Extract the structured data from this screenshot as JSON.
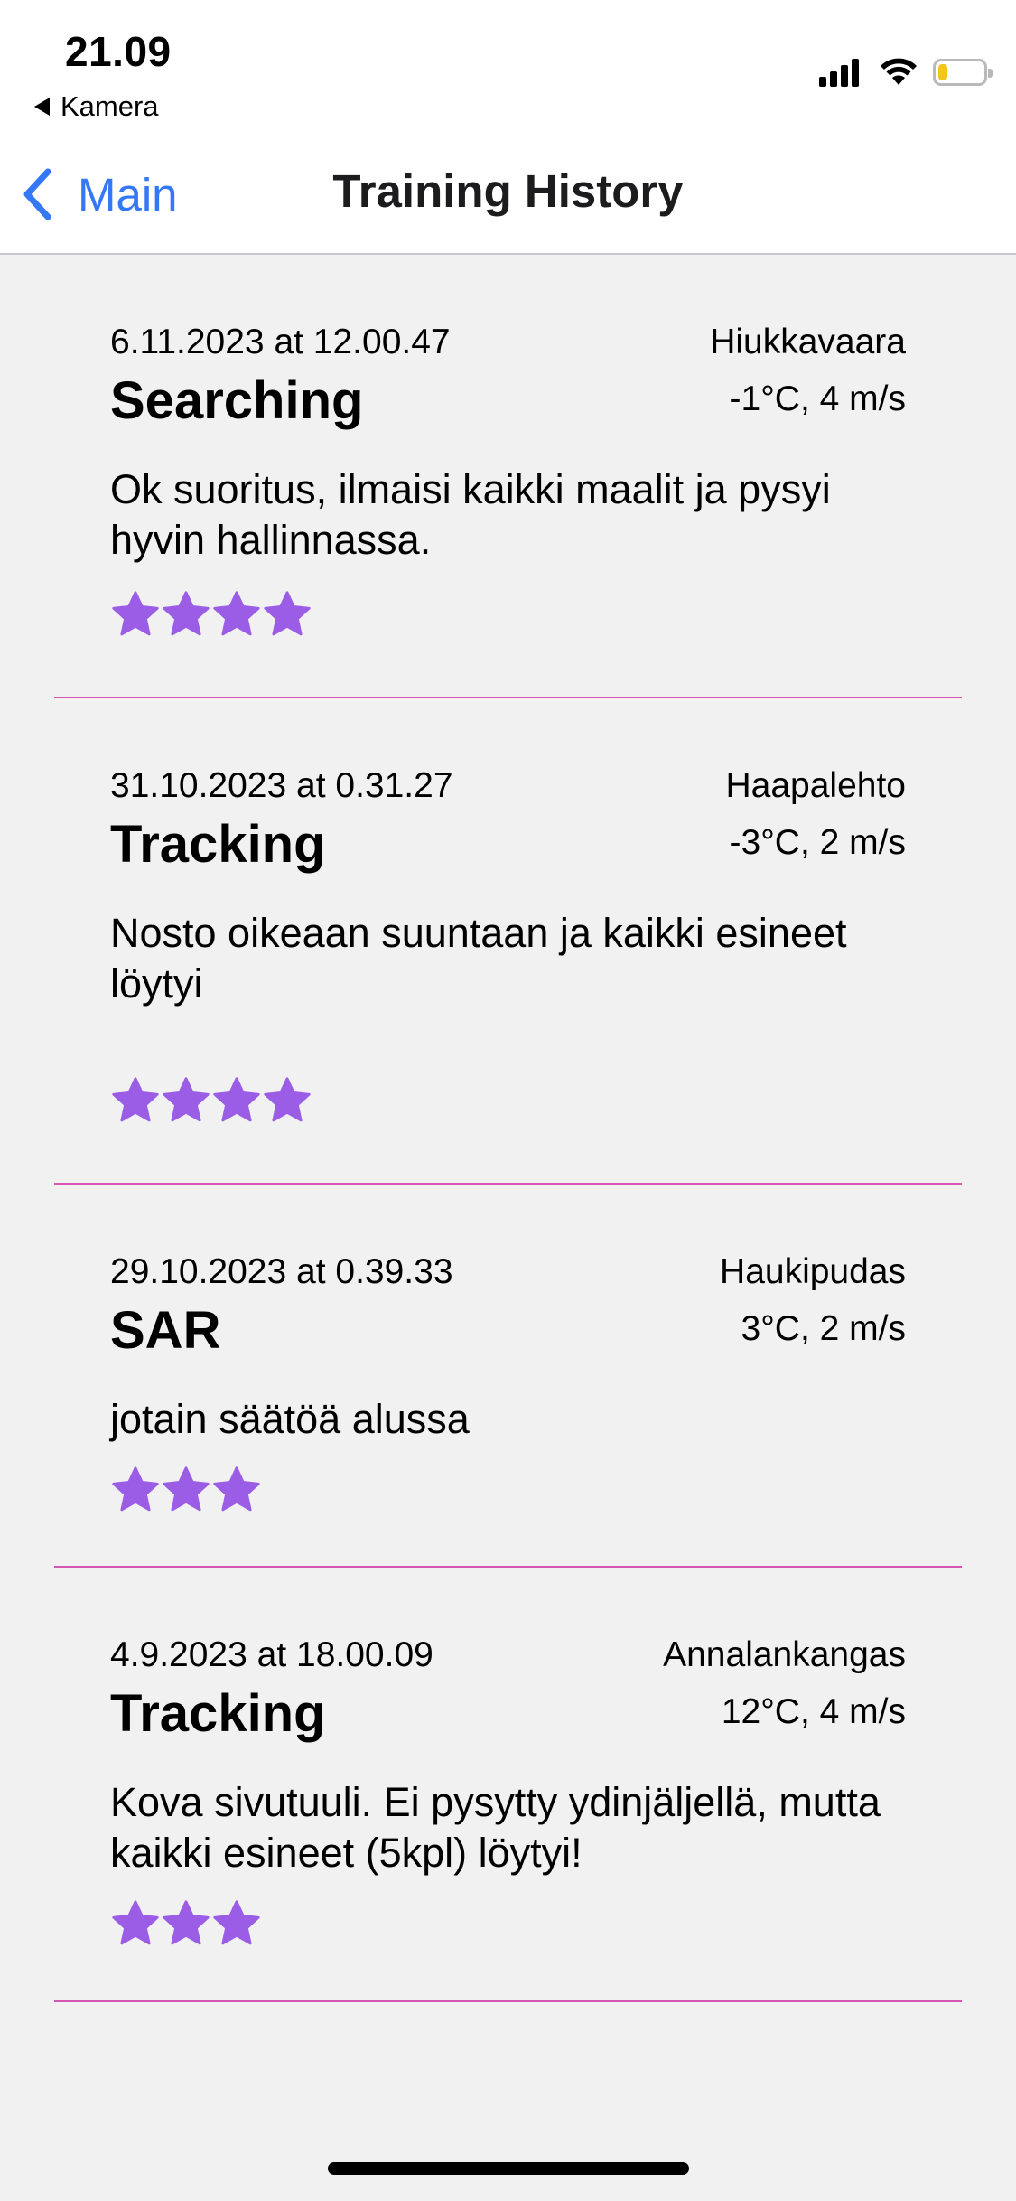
{
  "status_bar": {
    "time": "21.09",
    "back_app": "Kamera",
    "battery_level": 0.2,
    "battery_color": "#f6c51c"
  },
  "nav": {
    "back_label": "Main",
    "title": "Training History",
    "accent_color": "#3478f6"
  },
  "entries": [
    {
      "date": "6.11.2023 at 12.00.47",
      "type": "Searching",
      "location": "Hiukkavaara",
      "weather": "-1°C, 4 m/s",
      "note": "Ok suoritus, ilmaisi kaikki maalit ja pysyi hyvin hallinnassa.",
      "rating": 4
    },
    {
      "date": "31.10.2023 at 0.31.27",
      "type": "Tracking",
      "location": "Haapalehto",
      "weather": "-3°C, 2 m/s",
      "note": "Nosto oikeaan suuntaan ja kaikki esineet löytyi",
      "rating": 4
    },
    {
      "date": "29.10.2023 at 0.39.33",
      "type": "SAR",
      "location": "Haukipudas",
      "weather": "3°C, 2 m/s",
      "note": "jotain säätöä alussa",
      "rating": 3
    },
    {
      "date": "4.9.2023 at 18.00.09",
      "type": "Tracking",
      "location": "Annalankangas",
      "weather": "12°C, 4 m/s",
      "note": "Kova sivutuuli. Ei pysytty ydinjäljellä, mutta kaikki esineet (5kpl) löytyi!",
      "rating": 3
    }
  ],
  "colors": {
    "star": "#9b5de5",
    "separator": "#d655b2",
    "background": "#f1f1f2"
  }
}
